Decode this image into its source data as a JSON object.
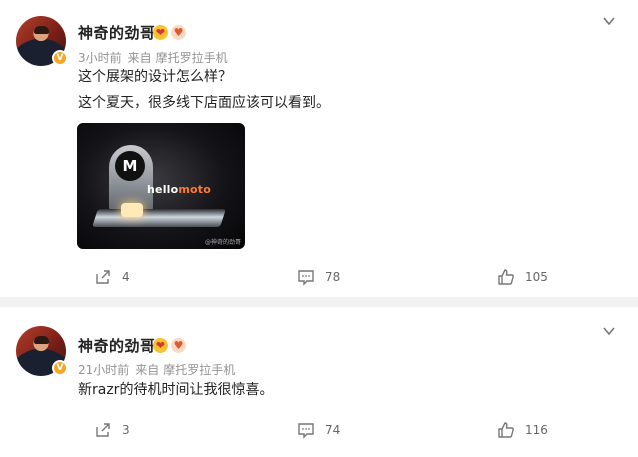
{
  "posts": [
    {
      "author": "神奇的劲哥",
      "time": "3小时前",
      "source_label": "来自",
      "source": "摩托罗拉手机",
      "lines": [
        "这个展架的设计怎么样？",
        "这个夏天，很多线下店面应该可以看到。"
      ],
      "image": {
        "logo_glyph": "M",
        "brand_hello": "hello",
        "brand_moto": "moto",
        "watermark": "@神奇的劲哥"
      },
      "repost_count": "4",
      "comment_count": "78",
      "like_count": "105"
    },
    {
      "author": "神奇的劲哥",
      "time": "21小时前",
      "source_label": "来自",
      "source": "摩托罗拉手机",
      "lines": [
        "新razr的待机时间让我很惊喜。"
      ],
      "repost_count": "3",
      "comment_count": "74",
      "like_count": "116"
    }
  ],
  "icons": {
    "verified": "V",
    "emoji1": "❤",
    "emoji2": "♥"
  },
  "colors": {
    "accent": "#f5a623",
    "meta": "#939393",
    "page_bg": "#f2f2f2"
  }
}
